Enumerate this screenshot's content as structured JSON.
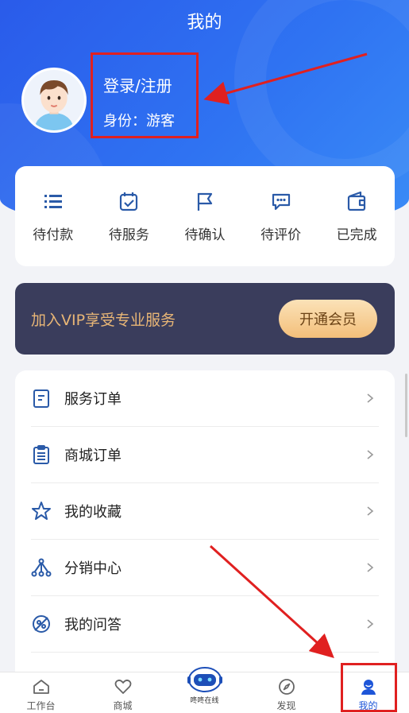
{
  "header": {
    "title": "我的"
  },
  "profile": {
    "login_label": "登录/注册",
    "identity_label": "身份：游客"
  },
  "orders": [
    {
      "label": "待付款",
      "icon": "list-icon"
    },
    {
      "label": "待服务",
      "icon": "calendar-check-icon"
    },
    {
      "label": "待确认",
      "icon": "flag-icon"
    },
    {
      "label": "待评价",
      "icon": "comment-icon"
    },
    {
      "label": "已完成",
      "icon": "wallet-icon"
    }
  ],
  "vip": {
    "text": "加入VIP享受专业服务",
    "button": "开通会员"
  },
  "menu": [
    {
      "label": "服务订单",
      "icon": "document-icon"
    },
    {
      "label": "商城订单",
      "icon": "clipboard-icon"
    },
    {
      "label": "我的收藏",
      "icon": "star-icon"
    },
    {
      "label": "分销中心",
      "icon": "network-icon"
    },
    {
      "label": "我的问答",
      "icon": "qa-icon"
    }
  ],
  "tabbar": [
    {
      "label": "工作台",
      "icon": "home-icon"
    },
    {
      "label": "商城",
      "icon": "heart-icon"
    },
    {
      "label": "咚咚在线",
      "icon": "robot-icon"
    },
    {
      "label": "发现",
      "icon": "compass-icon"
    },
    {
      "label": "我的",
      "icon": "user-icon"
    }
  ],
  "colors": {
    "primary": "#2f6cf0",
    "vip_bg": "#3a3d5c",
    "vip_gold": "#e8b676",
    "highlight": "#e02020"
  }
}
